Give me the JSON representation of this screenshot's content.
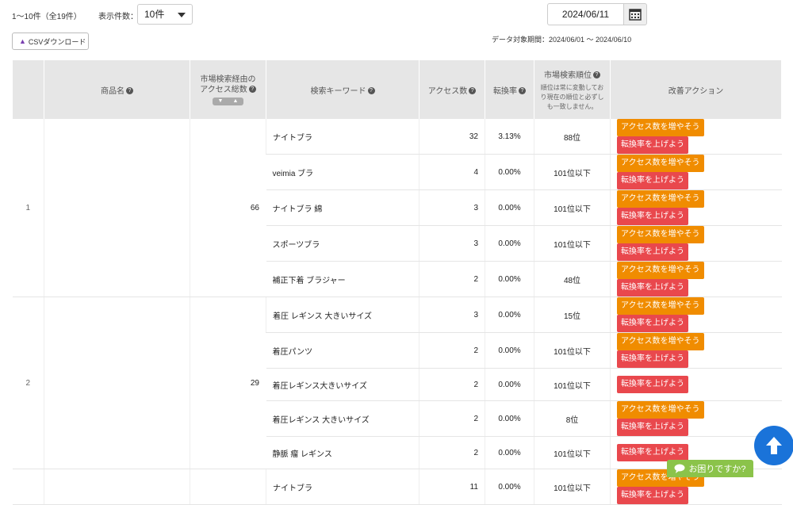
{
  "toolbar": {
    "range_text": "1〜10件（全19件）",
    "per_page_label": "表示件数：",
    "per_page_value": "10件",
    "csv_label": "CSVダウンロード",
    "date_value": "2024/06/11",
    "period_text": "データ対象期間：2024/06/01 〜 2024/06/10"
  },
  "table": {
    "headers": {
      "product": "商品名",
      "total_access": "市場検索経由のアクセス総数",
      "keyword": "検索キーワード",
      "access": "アクセス数",
      "conversion": "転換率",
      "rank": "市場検索順位",
      "rank_note": "順位は常に変動しており現在の順位と必ずしも一致しません。",
      "actions": "改善アクション"
    },
    "groups": [
      {
        "index": "1",
        "total": "66",
        "rows": [
          {
            "keyword": "ナイトブラ",
            "access": "32",
            "conversion": "3.13%",
            "rank": "88位",
            "actions": [
              "increase",
              "convert"
            ]
          },
          {
            "keyword": "veimia ブラ",
            "access": "4",
            "conversion": "0.00%",
            "rank": "101位以下",
            "actions": [
              "increase",
              "convert"
            ]
          },
          {
            "keyword": "ナイトブラ 綿",
            "access": "3",
            "conversion": "0.00%",
            "rank": "101位以下",
            "actions": [
              "increase",
              "convert"
            ]
          },
          {
            "keyword": "スポーツブラ",
            "access": "3",
            "conversion": "0.00%",
            "rank": "101位以下",
            "actions": [
              "increase",
              "convert"
            ]
          },
          {
            "keyword": "補正下着 ブラジャー",
            "access": "2",
            "conversion": "0.00%",
            "rank": "48位",
            "actions": [
              "increase",
              "convert"
            ]
          }
        ]
      },
      {
        "index": "2",
        "total": "29",
        "rows": [
          {
            "keyword": "着圧 レギンス 大きいサイズ",
            "access": "3",
            "conversion": "0.00%",
            "rank": "15位",
            "actions": [
              "increase",
              "convert"
            ]
          },
          {
            "keyword": "着圧パンツ",
            "access": "2",
            "conversion": "0.00%",
            "rank": "101位以下",
            "actions": [
              "increase",
              "convert"
            ]
          },
          {
            "keyword": "着圧レギンス大きいサイズ",
            "access": "2",
            "conversion": "0.00%",
            "rank": "101位以下",
            "actions": [
              "convert"
            ]
          },
          {
            "keyword": "着圧レギンス 大きいサイズ",
            "access": "2",
            "conversion": "0.00%",
            "rank": "8位",
            "actions": [
              "increase",
              "convert"
            ]
          },
          {
            "keyword": "静脈 瘤 レギンス",
            "access": "2",
            "conversion": "0.00%",
            "rank": "101位以下",
            "actions": [
              "convert"
            ]
          }
        ]
      },
      {
        "index": "",
        "total": "",
        "rows": [
          {
            "keyword": "ナイトブラ",
            "access": "11",
            "conversion": "0.00%",
            "rank": "101位以下",
            "actions": [
              "increase",
              "convert"
            ]
          }
        ]
      }
    ],
    "action_labels": {
      "increase": "アクセス数を増やそう",
      "convert": "転換率を上げよう"
    }
  },
  "help": {
    "label": "お困りですか?"
  },
  "colors": {
    "orange": "#f08c00",
    "red": "#e9484d",
    "scroll_blue": "#1a73d9",
    "help_green": "#8bc34a"
  },
  "icons": {
    "calendar": "calendar-icon",
    "scroll_top": "arrow-up-icon",
    "sort": "sort-icon",
    "help": "help-icon",
    "chat": "chat-bubble-icon"
  }
}
